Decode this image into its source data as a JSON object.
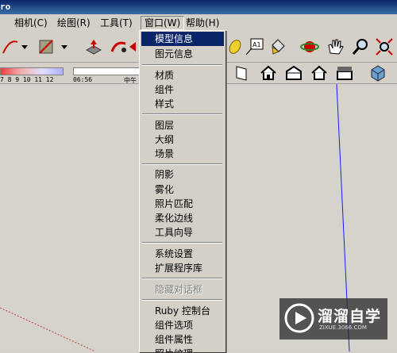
{
  "titlebar": {
    "text": "ro"
  },
  "menubar": {
    "items": [
      {
        "label": "相机(C)"
      },
      {
        "label": "绘图(R)"
      },
      {
        "label": "工具(T)"
      },
      {
        "label": "窗口(W)"
      },
      {
        "label": "帮助(H)"
      }
    ]
  },
  "shadowbar": {
    "month_ticks": "7  8  9  10 11 12",
    "time": "06:56",
    "noon": "中午"
  },
  "dropdown": {
    "items": [
      {
        "label": "模型信息",
        "state": "highlighted"
      },
      {
        "label": "图元信息"
      },
      {
        "label": "材质"
      },
      {
        "label": "组件"
      },
      {
        "label": "样式"
      },
      {
        "label": "图层"
      },
      {
        "label": "大纲"
      },
      {
        "label": "场景"
      },
      {
        "label": "阴影"
      },
      {
        "label": "雾化"
      },
      {
        "label": "照片匹配"
      },
      {
        "label": "柔化边线"
      },
      {
        "label": "工具向导"
      },
      {
        "label": "系统设置"
      },
      {
        "label": "扩展程序库"
      },
      {
        "label": "隐藏对话框",
        "state": "disabled"
      },
      {
        "label": "Ruby 控制台"
      },
      {
        "label": "组件选项"
      },
      {
        "label": "组件属性"
      },
      {
        "label": "照片纹理"
      }
    ]
  },
  "toolbar": {
    "icons": [
      "arc-icon",
      "dropdown-arrow-icon",
      "eraser-icon",
      "dropdown-arrow-icon",
      "push-pull-icon",
      "follow-me-icon",
      "offset-icon",
      "tape-icon",
      "text-label-icon",
      "paint-bucket-icon",
      "orbit-icon",
      "pan-icon",
      "zoom-icon",
      "zoom-extents-icon"
    ],
    "text_label": "A1"
  },
  "watermark": {
    "title": "溜溜自学",
    "url": "ZIXUE.3066.COM"
  },
  "colors": {
    "highlight": "#0a246a",
    "axis_blue": "#1a1aff",
    "axis_red": "#c04040"
  }
}
